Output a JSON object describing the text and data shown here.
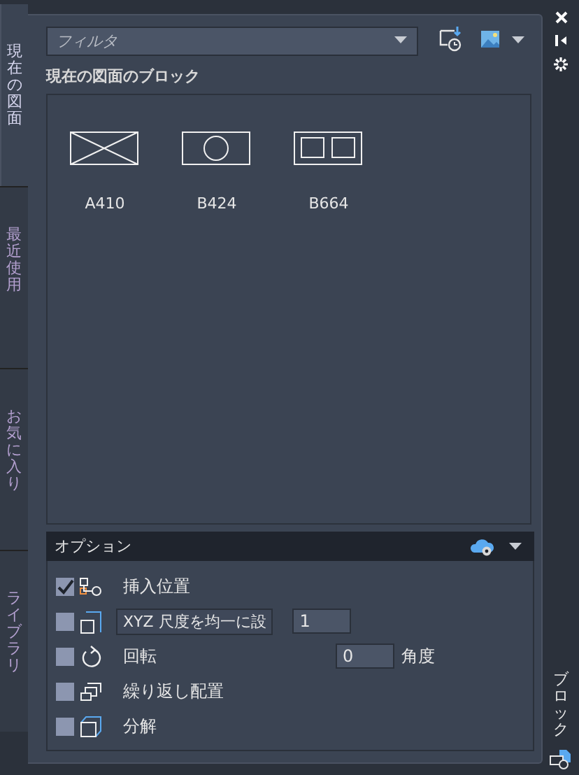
{
  "side_tabs": [
    {
      "label": "現在の図面",
      "selected": true
    },
    {
      "label": "最近使用",
      "selected": false
    },
    {
      "label": "お気に入り",
      "selected": false
    },
    {
      "label": "ライブラリ",
      "selected": false
    }
  ],
  "filter": {
    "placeholder": "フィルタ"
  },
  "section_title": "現在の図面のブロック",
  "blocks": [
    {
      "name": "A410",
      "kind": "cross"
    },
    {
      "name": "B424",
      "kind": "circle"
    },
    {
      "name": "B664",
      "kind": "squares"
    }
  ],
  "options": {
    "title": "オプション",
    "rows": [
      {
        "kind": "insert",
        "label": "挿入位置",
        "checked": true
      },
      {
        "kind": "scale",
        "label": "XYZ 尺度を均一に設",
        "value": "1",
        "checked": false
      },
      {
        "kind": "rotate",
        "label": "回転",
        "value": "0",
        "unit": "角度",
        "checked": false
      },
      {
        "kind": "repeat",
        "label": "繰り返し配置",
        "checked": false
      },
      {
        "kind": "explode",
        "label": "分解",
        "checked": false
      }
    ]
  },
  "palette_title": "ブロック"
}
